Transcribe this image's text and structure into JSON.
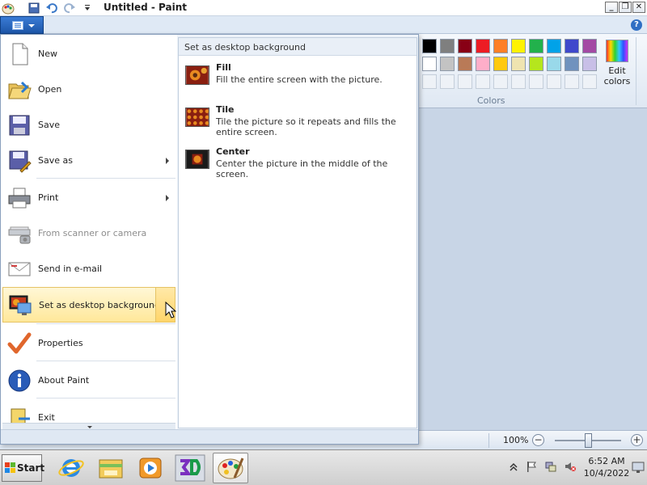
{
  "window": {
    "title": "Untitled - Paint",
    "controls": {
      "minimize": "_",
      "restore": "❐",
      "close": "✕"
    }
  },
  "ribbon": {
    "help_symbol": "?",
    "colors_group_label": "Colors",
    "edit_colors_label": "Edit colors",
    "palette_row1": [
      "#000000",
      "#7f7f7f",
      "#880015",
      "#ed1c24",
      "#ff7f27",
      "#fff200",
      "#22b14c",
      "#00a2e8",
      "#3f48cc",
      "#a349a4"
    ],
    "palette_row2": [
      "#ffffff",
      "#c3c3c3",
      "#b97a57",
      "#ffaec9",
      "#ffc90e",
      "#efe4b0",
      "#b5e61d",
      "#99d9ea",
      "#7092be",
      "#c8bfe7"
    ]
  },
  "app_menu": {
    "items": [
      {
        "label": "New",
        "icon": "new-file-icon"
      },
      {
        "label": "Open",
        "icon": "open-folder-icon"
      },
      {
        "label": "Save",
        "icon": "floppy-disk-icon"
      },
      {
        "label": "Save as",
        "icon": "save-as-icon",
        "submenu": true
      },
      {
        "label": "Print",
        "icon": "printer-icon",
        "submenu": true
      },
      {
        "label": "From scanner or camera",
        "icon": "scanner-icon",
        "disabled": true
      },
      {
        "label": "Send in e-mail",
        "icon": "email-icon"
      },
      {
        "label": "Set as desktop background",
        "icon": "desktop-background-icon",
        "submenu": true,
        "highlighted": true
      },
      {
        "label": "Properties",
        "icon": "checkmark-icon"
      },
      {
        "label": "About Paint",
        "icon": "info-icon"
      },
      {
        "label": "Exit",
        "icon": "exit-icon"
      }
    ],
    "submenu": {
      "title": "Set as desktop background",
      "items": [
        {
          "title": "Fill",
          "description": "Fill the entire screen with the picture."
        },
        {
          "title": "Tile",
          "description": "Tile the picture so it repeats and fills the entire screen."
        },
        {
          "title": "Center",
          "description": "Center the picture in the middle of the screen."
        }
      ]
    }
  },
  "statusbar": {
    "zoom": "100%",
    "zoom_minus": "−",
    "zoom_plus": "+"
  },
  "taskbar": {
    "start_label": "Start",
    "apps": [
      "internet-explorer-icon",
      "file-explorer-icon",
      "media-player-icon",
      "3d-app-icon",
      "paint-icon"
    ],
    "clock_time": "6:52 AM",
    "clock_date": "10/4/2022"
  }
}
